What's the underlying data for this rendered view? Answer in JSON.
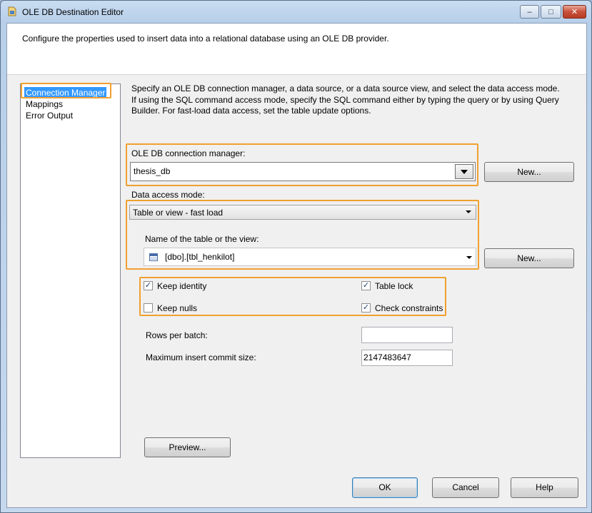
{
  "window": {
    "title": "OLE DB Destination Editor",
    "caption_min": "–",
    "caption_max": "□",
    "caption_close": "✕"
  },
  "header": {
    "description": "Configure the properties used to insert data into a relational database using an OLE DB provider."
  },
  "nav": {
    "items": [
      {
        "label": "Connection Manager",
        "selected": true
      },
      {
        "label": "Mappings",
        "selected": false
      },
      {
        "label": "Error Output",
        "selected": false
      }
    ]
  },
  "main": {
    "description": "Specify an OLE DB connection manager, a data source, or a data source view, and select the data access mode. If using the SQL command access mode, specify the SQL command either by typing the query or by using Query Builder. For fast-load data access, set the table update options.",
    "connection_manager": {
      "label": "OLE DB connection manager:",
      "value": "thesis_db",
      "new_button": "New..."
    },
    "data_access_mode": {
      "label": "Data access mode:",
      "value": "Table or view - fast load"
    },
    "table_view": {
      "label": "Name of the table or the view:",
      "value": "[dbo].[tbl_henkilot]",
      "new_button": "New..."
    },
    "options": {
      "keep_identity": {
        "label": "Keep identity",
        "checked": true
      },
      "keep_nulls": {
        "label": "Keep nulls",
        "checked": false
      },
      "table_lock": {
        "label": "Table lock",
        "checked": true
      },
      "check_constraints": {
        "label": "Check constraints",
        "checked": true
      },
      "check_mark": "✓"
    },
    "rows_per_batch": {
      "label": "Rows per batch:",
      "value": ""
    },
    "max_commit": {
      "label": "Maximum insert commit size:",
      "value": "2147483647"
    },
    "preview_button": "Preview..."
  },
  "footer": {
    "ok": "OK",
    "cancel": "Cancel",
    "help": "Help"
  },
  "colors": {
    "highlight_border": "#f0a030",
    "selection": "#3399ff"
  }
}
